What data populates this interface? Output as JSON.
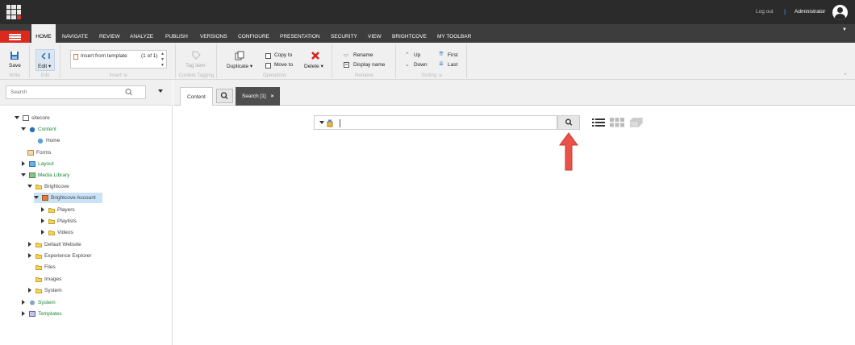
{
  "topbar": {
    "logout_label": "Log out",
    "separator": "|",
    "user_name": "Administrator"
  },
  "tabs": [
    {
      "label": "HOME"
    },
    {
      "label": "NAVIGATE"
    },
    {
      "label": "REVIEW"
    },
    {
      "label": "ANALYZE"
    },
    {
      "label": "PUBLISH"
    },
    {
      "label": "VERSIONS"
    },
    {
      "label": "CONFIGURE"
    },
    {
      "label": "PRESENTATION"
    },
    {
      "label": "SECURITY"
    },
    {
      "label": "VIEW"
    },
    {
      "label": "BRIGHTCOVE"
    },
    {
      "label": "MY TOOLBAR"
    }
  ],
  "ribbon": {
    "write": {
      "save": "Save",
      "group": "Write"
    },
    "edit": {
      "edit": "Edit",
      "group": "Edit"
    },
    "insert": {
      "template": "Insert from template",
      "count": "(1 of 1)",
      "group": "Insert"
    },
    "tagging": {
      "tag_item": "Tag item",
      "group": "Content Tagging"
    },
    "operations": {
      "duplicate": "Duplicate",
      "copy_to": "Copy to",
      "move_to": "Move to",
      "delete": "Delete",
      "group": "Operations"
    },
    "rename": {
      "rename": "Rename",
      "display_name": "Display name",
      "group": "Rename"
    },
    "sorting": {
      "up": "Up",
      "down": "Down",
      "first": "First",
      "last": "Last",
      "group": "Sorting"
    }
  },
  "sidebar": {
    "search_placeholder": "Search",
    "tree": [
      {
        "label": "sitecore"
      },
      {
        "label": "Content"
      },
      {
        "label": "Home"
      },
      {
        "label": "Forms"
      },
      {
        "label": "Layout"
      },
      {
        "label": "Media Library"
      },
      {
        "label": "Brightcove"
      },
      {
        "label": "Brightcove Account"
      },
      {
        "label": "Players"
      },
      {
        "label": "Playlists"
      },
      {
        "label": "Videos"
      },
      {
        "label": "Default Website"
      },
      {
        "label": "Experience Explorer"
      },
      {
        "label": "Files"
      },
      {
        "label": "Images"
      },
      {
        "label": "System"
      },
      {
        "label": "System"
      },
      {
        "label": "Templates"
      }
    ]
  },
  "main": {
    "tab_content": "Content",
    "tab_search": "Search [1]",
    "close": "×",
    "search_value": ""
  },
  "colors": {
    "topbar": "#2b2b2b",
    "tabbar": "#3d3d3d",
    "menu_button": "#dc291e",
    "tree_green": "#1a8a3a",
    "annotation_arrow": "#e8524a"
  }
}
